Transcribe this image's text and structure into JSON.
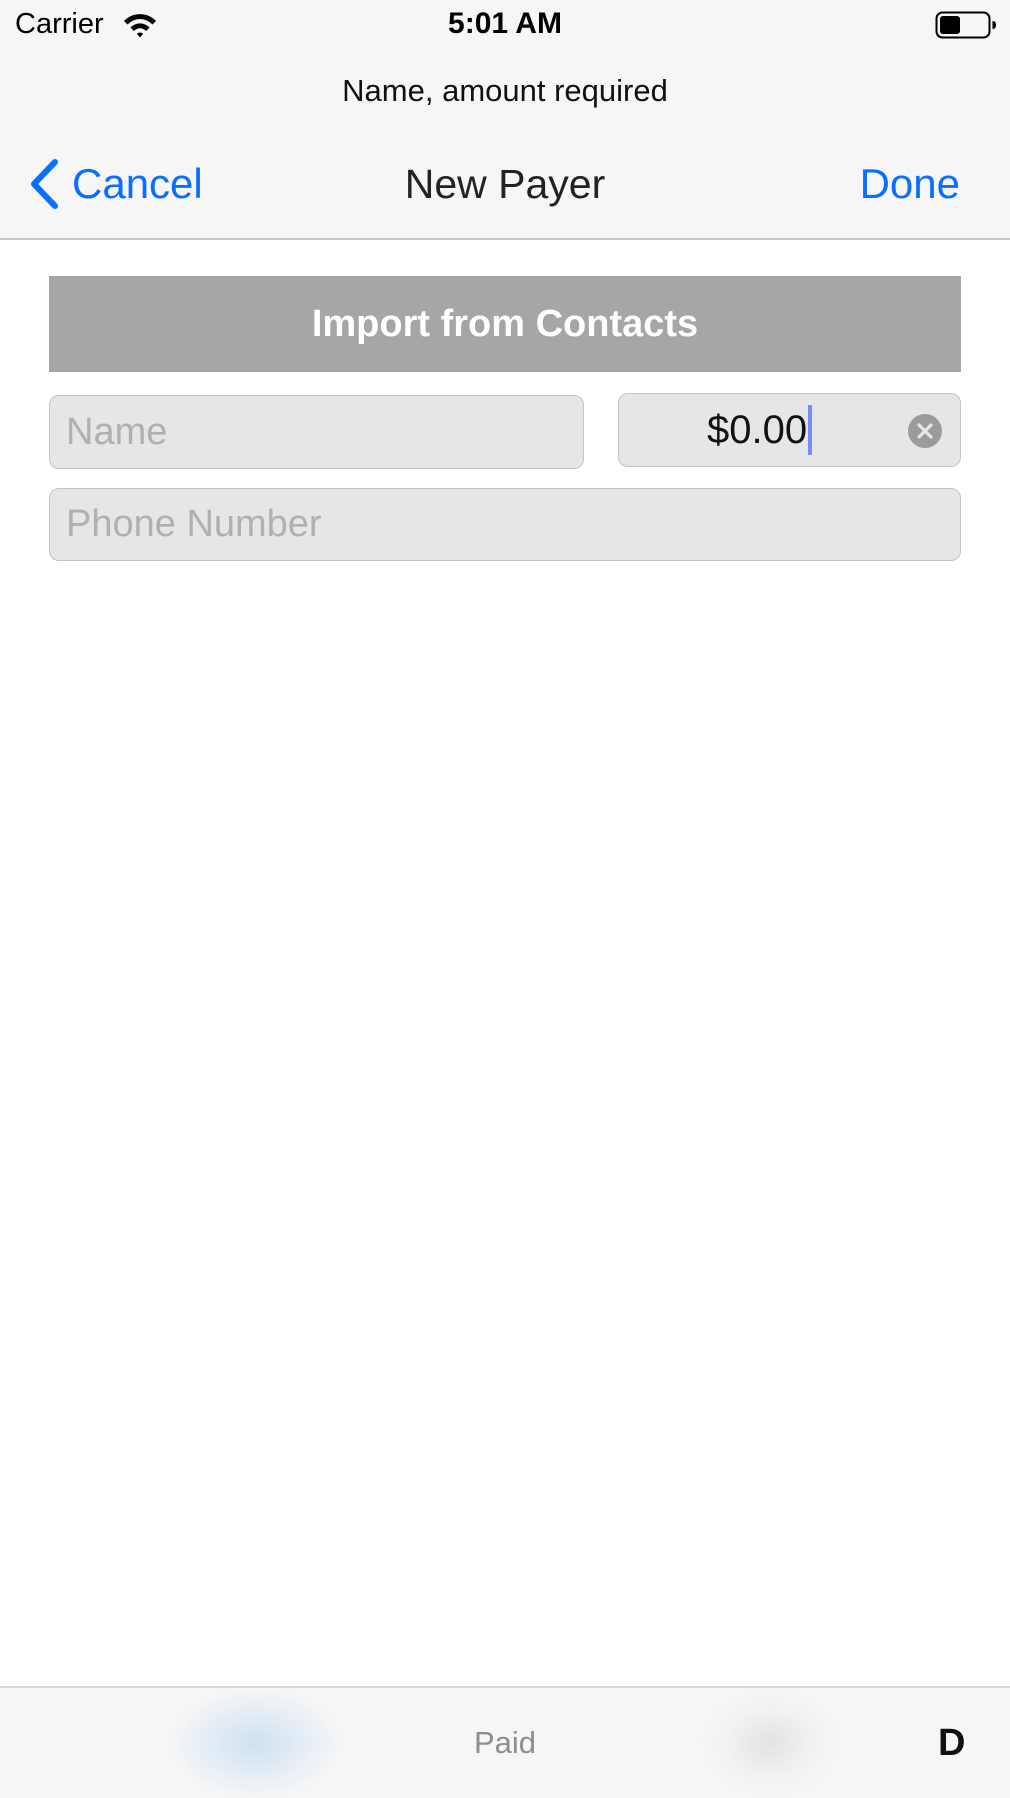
{
  "status_bar": {
    "carrier": "Carrier",
    "time": "5:01 AM",
    "icons": [
      "wifi-icon",
      "battery-icon"
    ]
  },
  "prompt": "Name, amount required",
  "nav": {
    "back_label": "Cancel",
    "back_icon": "chevron-left-icon",
    "title": "New Payer",
    "done_label": "Done"
  },
  "form": {
    "import_button_label": "Import from Contacts",
    "name_placeholder": "Name",
    "amount_value": "$0.00",
    "amount_clear_icon": "clear-icon",
    "phone_placeholder": "Phone Number"
  },
  "bottom_bar": {
    "center_label": "Paid",
    "right_label_partial": "D"
  },
  "colors": {
    "accent": "#0a6fff",
    "bar_background": "#f6f6f6",
    "import_button_background": "#a6a6a6",
    "field_background": "#e6e6e6",
    "placeholder": "#b0b0b0",
    "caret": "#7c8cf0"
  }
}
